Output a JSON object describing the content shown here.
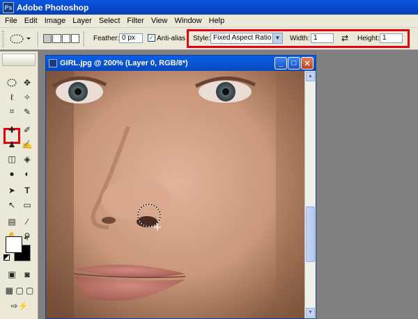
{
  "app": {
    "title": "Adobe Photoshop",
    "logo_text": "Ps"
  },
  "menu": [
    "File",
    "Edit",
    "Image",
    "Layer",
    "Select",
    "Filter",
    "View",
    "Window",
    "Help"
  ],
  "options": {
    "feather_label": "Feather:",
    "feather_value": "0 px",
    "antialias_label": "Anti-alias",
    "antialias_checked": "✓",
    "style_label": "Style:",
    "style_value": "Fixed Aspect Ratio",
    "width_label": "Width:",
    "width_value": "1",
    "swap_icon": "⇄",
    "height_label": "Height:",
    "height_value": "1"
  },
  "document": {
    "title": "GIRL.jpg @ 200% (Layer 0, RGB/8*)",
    "min_label": "_",
    "max_label": "□",
    "close_label": "✕"
  },
  "colors": {
    "highlight": "#e8000e",
    "titlebar": "#0a56e0",
    "chrome": "#ece9d8"
  }
}
